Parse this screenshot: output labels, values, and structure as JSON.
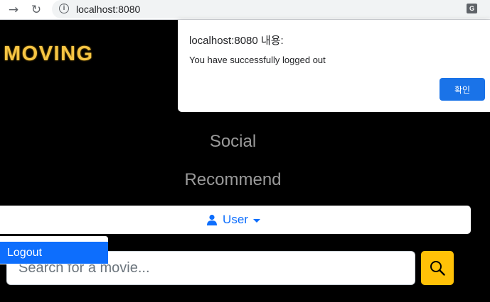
{
  "browser": {
    "url": "localhost:8080",
    "back_icon": "back-arrow-icon",
    "reload_icon": "reload-icon",
    "info_icon": "info-icon",
    "translate_icon": "translate-icon"
  },
  "header": {
    "logo": "MOVING"
  },
  "nav": {
    "items": [
      {
        "label": "Social"
      },
      {
        "label": "Recommend"
      }
    ],
    "user_label": "User",
    "user_icon": "person-icon"
  },
  "dropdown": {
    "items": [
      {
        "label": "Logout"
      }
    ]
  },
  "search": {
    "placeholder": "Search for a movie...",
    "button_icon": "search-icon"
  },
  "dialog": {
    "title": "localhost:8080 내용:",
    "message": "You have successfully logged out",
    "ok_label": "확인"
  },
  "colors": {
    "logo": "#f6c544",
    "primary": "#0d6efd",
    "search_button": "#ffc107",
    "dialog_button": "#1a73e8",
    "background": "#000000"
  }
}
